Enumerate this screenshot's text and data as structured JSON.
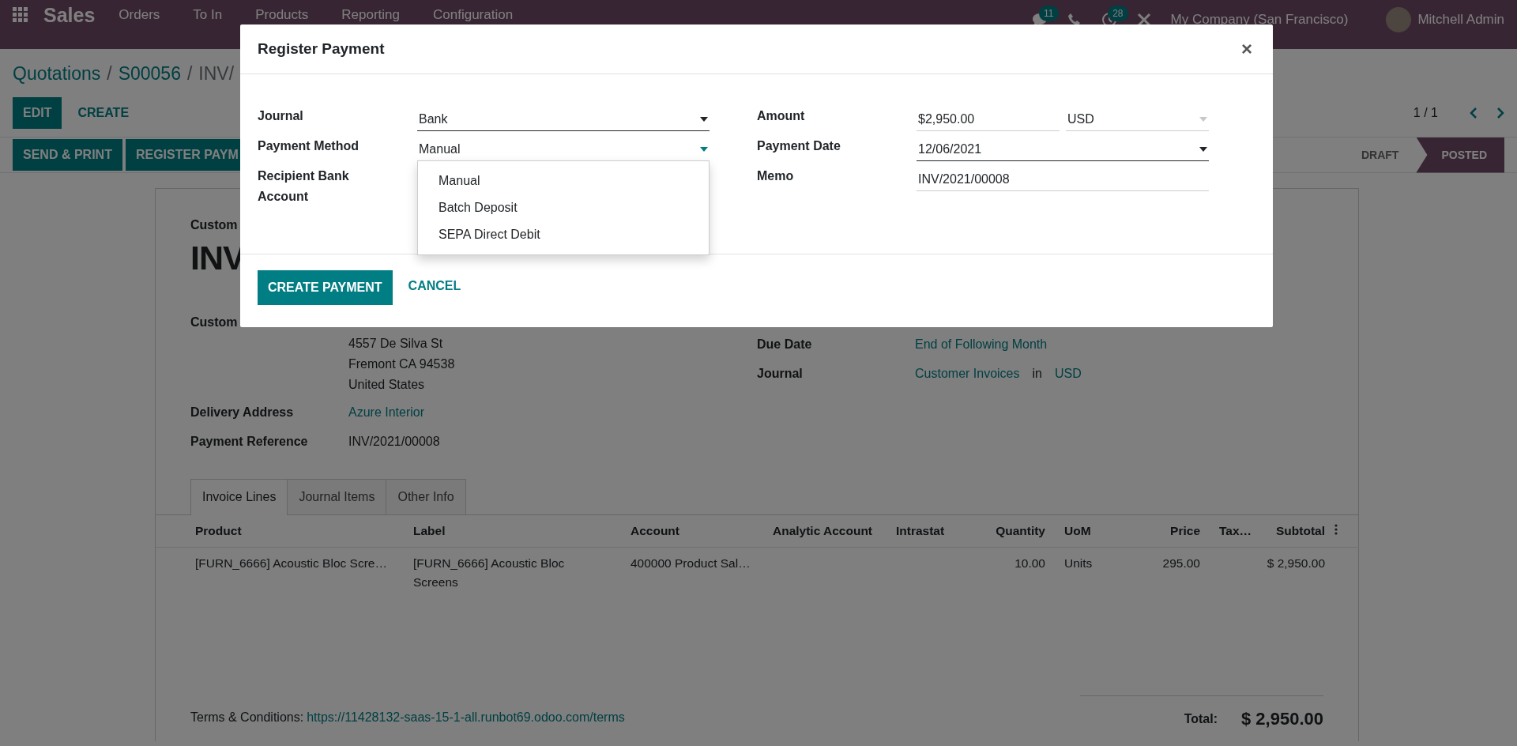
{
  "navbar": {
    "app_name": "Sales",
    "menu": [
      "Orders",
      "To In",
      "Products",
      "Reporting",
      "Configuration"
    ],
    "messages_badge": "11",
    "activities_badge": "28",
    "company": "My Company (San Francisco)",
    "user": "Mitchell Admin"
  },
  "breadcrumb": {
    "separator": "/",
    "items": [
      {
        "label": "Quotations",
        "kind": "link"
      },
      {
        "label": "S00056",
        "kind": "link"
      },
      {
        "label": "INV/",
        "kind": "current"
      }
    ]
  },
  "control_buttons": [
    {
      "label": "EDIT",
      "kind": "primary"
    },
    {
      "label": "CREATE",
      "kind": "link"
    }
  ],
  "pager": "1 / 1",
  "action_buttons": [
    "SEND & PRINT",
    "REGISTER PAYM"
  ],
  "statuses": [
    {
      "label": "DRAFT",
      "selected": false
    },
    {
      "label": "POSTED",
      "selected": true
    }
  ],
  "sheet": {
    "type_label": "Custom",
    "title": "INV",
    "customer_label": "Custom",
    "address_lines": [
      "4557 De Silva St",
      "Fremont CA 94538",
      "United States"
    ],
    "fields_left": [
      {
        "label": "Delivery Address",
        "value": "Azure Interior",
        "kind": "link"
      },
      {
        "label": "Payment Reference",
        "value": "INV/2021/00008",
        "kind": "text"
      }
    ],
    "fields_right": [
      {
        "label": "Due Date",
        "parts": [
          {
            "text": "End of Following Month",
            "kind": "link"
          }
        ]
      },
      {
        "label": "Journal",
        "parts": [
          {
            "text": "Customer Invoices",
            "kind": "link"
          },
          {
            "text": "in",
            "kind": "text"
          },
          {
            "text": "USD",
            "kind": "link"
          }
        ]
      }
    ],
    "tabs": [
      {
        "label": "Invoice Lines",
        "selected": true
      },
      {
        "label": "Journal Items",
        "selected": false
      },
      {
        "label": "Other Info",
        "selected": false
      }
    ],
    "table": {
      "columns": [
        "Product",
        "Label",
        "Account",
        "Analytic Account",
        "Intrastat",
        "Quantity",
        "UoM",
        "Price",
        "Tax…",
        "Subtotal"
      ],
      "rows": [
        [
          "[FURN_6666] Acoustic Bloc Scre…",
          "[FURN_6666] Acoustic Bloc Screens",
          "400000 Product Sal…",
          "",
          "",
          "10.00",
          "Units",
          "295.00",
          "",
          "$ 2,950.00"
        ]
      ]
    },
    "terms_label": "Terms & Conditions:",
    "terms_link": "https://11428132-saas-15-1-all.runbot69.odoo.com/terms",
    "total_label": "Total:",
    "total_value": "$ 2,950.00"
  },
  "dialog": {
    "title": "Register Payment",
    "close": "×",
    "fields_left": [
      {
        "label": "Journal",
        "inputs": [
          {
            "value": "Bank",
            "kind": "select",
            "required": true
          }
        ]
      },
      {
        "label": "Payment Method",
        "inputs": [
          {
            "value": "Manual",
            "kind": "select",
            "focused": true,
            "options": [
              "Manual",
              "Batch Deposit",
              "SEPA Direct Debit"
            ]
          }
        ]
      },
      {
        "label": "Recipient Bank Account"
      }
    ],
    "fields_right": [
      {
        "label": "Amount",
        "inputs": [
          {
            "value": "$2,950.00",
            "kind": "input"
          },
          {
            "value": "USD",
            "kind": "select",
            "readonly": true
          }
        ]
      },
      {
        "label": "Payment Date",
        "inputs": [
          {
            "value": "12/06/2021",
            "kind": "select",
            "required": true
          }
        ]
      },
      {
        "label": "Memo",
        "inputs": [
          {
            "value": "INV/2021/00008",
            "kind": "input"
          }
        ]
      }
    ],
    "buttons": [
      {
        "label": "CREATE PAYMENT",
        "kind": "primary"
      },
      {
        "label": "CANCEL",
        "kind": "link"
      }
    ]
  }
}
